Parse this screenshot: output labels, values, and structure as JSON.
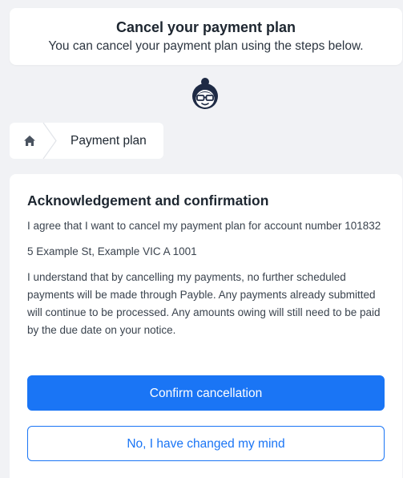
{
  "header": {
    "title": "Cancel your payment plan",
    "subtitle": "You can cancel your payment plan using the steps below."
  },
  "mascot": {
    "icon": "mascot-avatar-icon"
  },
  "breadcrumb": {
    "home_icon": "home-icon",
    "current": "Payment plan"
  },
  "acknowledgement": {
    "title": "Acknowledgement and confirmation",
    "agree_text": "I agree that I want to cancel my payment plan for account number 101832",
    "address": "5 Example St, Example VIC A 1001",
    "understand_text": "I understand that by cancelling my payments, no further scheduled payments will be made through Payble. Any payments already submitted will continue to be processed. Any amounts owing will still need to be paid by the due date on your notice."
  },
  "actions": {
    "confirm_label": "Confirm cancellation",
    "cancel_label": "No, I have changed my mind"
  },
  "colors": {
    "accent": "#1a75f5",
    "background": "#f1f2f5",
    "mascot_navy": "#1e2a44"
  }
}
